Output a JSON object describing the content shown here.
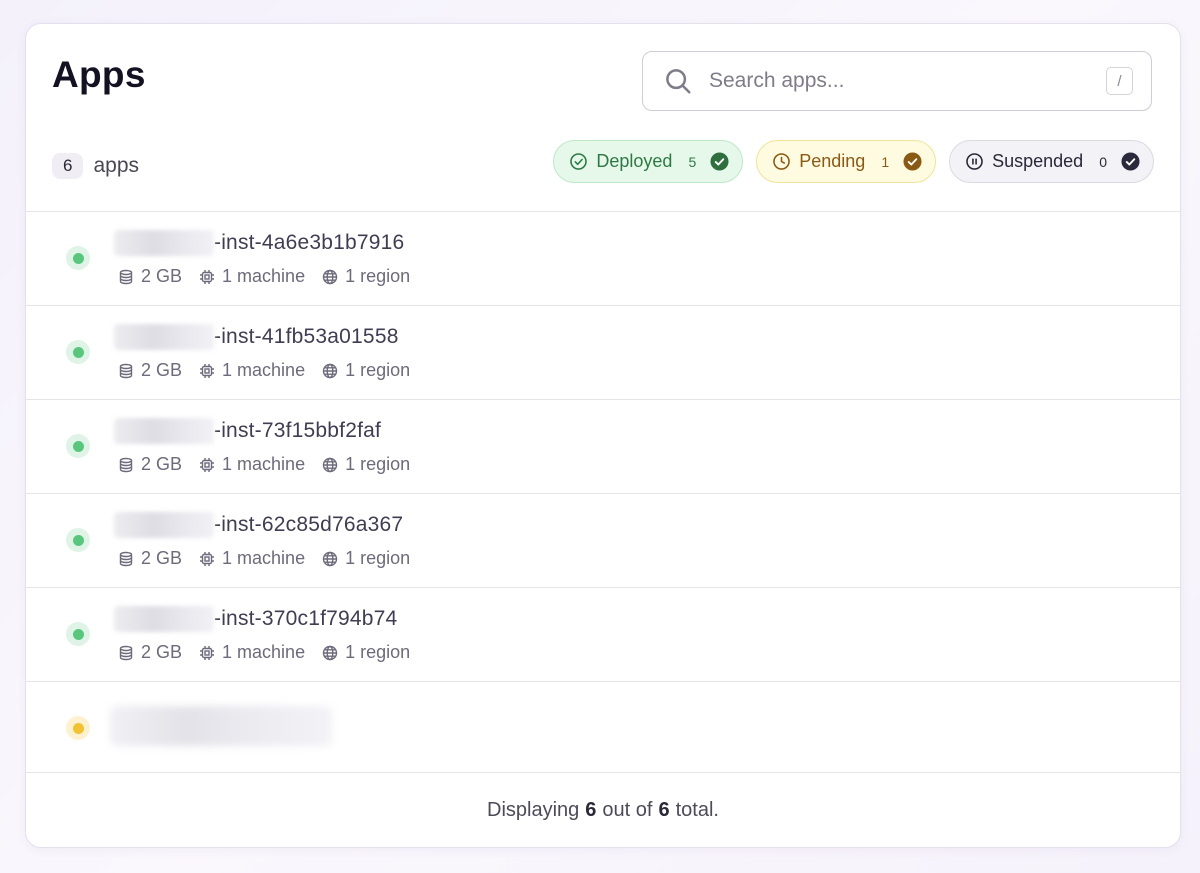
{
  "header": {
    "title": "Apps"
  },
  "search": {
    "placeholder": "Search apps...",
    "shortcut": "/"
  },
  "summary": {
    "count": "6",
    "label": "apps"
  },
  "filters": [
    {
      "label": "Deployed",
      "count": "5",
      "color": "#2f7a44"
    },
    {
      "label": "Pending",
      "count": "1",
      "color": "#8a5a14"
    },
    {
      "label": "Suspended",
      "count": "0",
      "color": "#2a2838"
    }
  ],
  "apps": [
    {
      "name": "-inst-4a6e3b1b7916",
      "memory": "2 GB",
      "machines": "1 machine",
      "regions": "1 region",
      "status": "deployed"
    },
    {
      "name": "-inst-41fb53a01558",
      "memory": "2 GB",
      "machines": "1 machine",
      "regions": "1 region",
      "status": "deployed"
    },
    {
      "name": "-inst-73f15bbf2faf",
      "memory": "2 GB",
      "machines": "1 machine",
      "regions": "1 region",
      "status": "deployed"
    },
    {
      "name": "-inst-62c85d76a367",
      "memory": "2 GB",
      "machines": "1 machine",
      "regions": "1 region",
      "status": "deployed"
    },
    {
      "name": "-inst-370c1f794b74",
      "memory": "2 GB",
      "machines": "1 machine",
      "regions": "1 region",
      "status": "deployed"
    },
    {
      "status": "pending"
    }
  ],
  "footer": {
    "prefix": "Displaying",
    "shown": "6",
    "middle": "out of",
    "total": "6",
    "suffix": "total."
  },
  "colors": {
    "deployed": "#58c77d",
    "pending": "#f1c232",
    "accent": "#141222"
  }
}
